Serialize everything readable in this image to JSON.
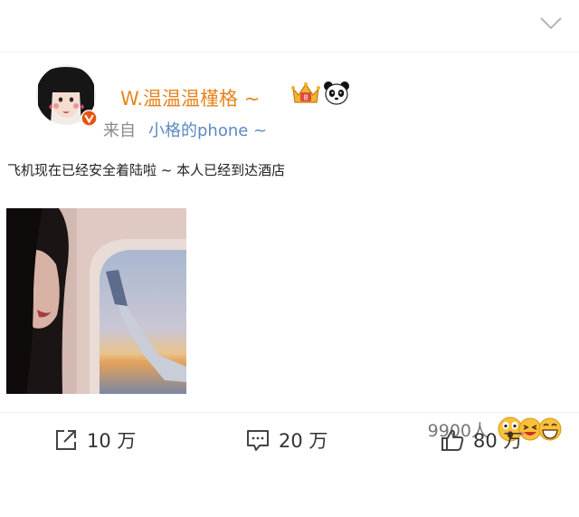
{
  "topbar": {
    "collapse_icon": "chevron-down-icon"
  },
  "post": {
    "author": {
      "name": "W.温温温槿格 ~",
      "name_color": "#e4851f",
      "verified_badge_color": "#e8530e",
      "badges": [
        "crown-icon",
        "panda-icon"
      ]
    },
    "source": {
      "label": "来自",
      "device": "小格的phone ~",
      "device_color": "#5b8ac2"
    },
    "text": "飞机现在已经安全着陆啦 ~ 本人已经到达酒店",
    "image": {
      "subject": "photo-airplane-window"
    },
    "reactions": {
      "count": "9900人",
      "emojis": [
        "surprised-emoji",
        "laughing-emoji",
        "grinning-emoji"
      ]
    }
  },
  "actions": {
    "repost": {
      "icon": "share-icon",
      "count": "10 万"
    },
    "comment": {
      "icon": "comment-icon",
      "count": "20 万"
    },
    "like": {
      "icon": "thumbs-up-icon",
      "count": "80 万"
    }
  }
}
